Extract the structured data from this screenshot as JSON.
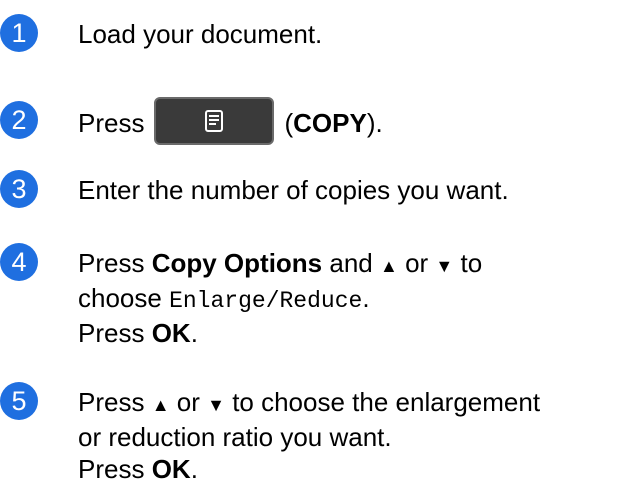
{
  "badge_color": "#1f6fe0",
  "steps": [
    {
      "number": "1",
      "line1": "Load your document."
    },
    {
      "number": "2",
      "press": "Press",
      "button_icon": "copy-document-icon",
      "open_paren": "(",
      "copy_label": "COPY",
      "close_paren": ")."
    },
    {
      "number": "3",
      "line1": "Enter the number of copies you want."
    },
    {
      "number": "4",
      "press": "Press",
      "copy_options": "Copy Options",
      "and": "and",
      "up": "▲",
      "or": "or",
      "down": "▼",
      "to": "to",
      "choose": "choose",
      "menu_value": "Enlarge/Reduce",
      "period": ".",
      "press2": "Press",
      "ok": "OK",
      "period2": "."
    },
    {
      "number": "5",
      "press": "Press",
      "up": "▲",
      "or": "or",
      "down": "▼",
      "line1_rest": "to choose the enlargement",
      "line2": "or reduction ratio you want.",
      "press2": "Press",
      "ok": "OK",
      "period2": "."
    }
  ]
}
